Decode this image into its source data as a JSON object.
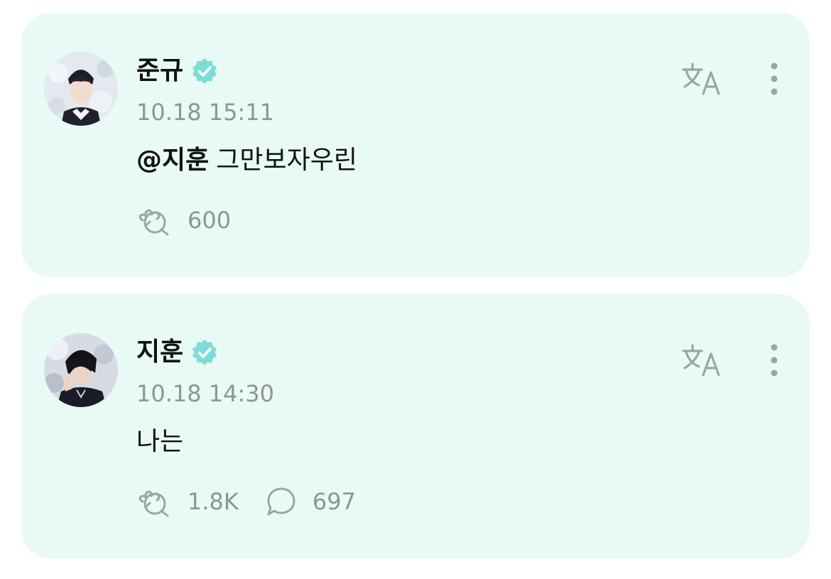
{
  "colors": {
    "card_bg": "#e8f9f6",
    "verified_badge": "#7ddcd6",
    "icon_gray": "#9aa6a4",
    "meta_text": "#8e9594",
    "primary_text": "#111111"
  },
  "posts": [
    {
      "author": "준규",
      "verified": true,
      "timestamp": "10.18 15:11",
      "mention": "@지훈",
      "text": "그만보자우린",
      "likes": "600",
      "comments": null,
      "icons": [
        "avatar",
        "verified-badge-icon",
        "translate-icon",
        "more-options-icon",
        "cheer-icon"
      ]
    },
    {
      "author": "지훈",
      "verified": true,
      "timestamp": "10.18 14:30",
      "mention": "",
      "text": "나는",
      "likes": "1.8K",
      "comments": "697",
      "icons": [
        "avatar",
        "verified-badge-icon",
        "translate-icon",
        "more-options-icon",
        "cheer-icon",
        "comment-icon"
      ]
    }
  ]
}
